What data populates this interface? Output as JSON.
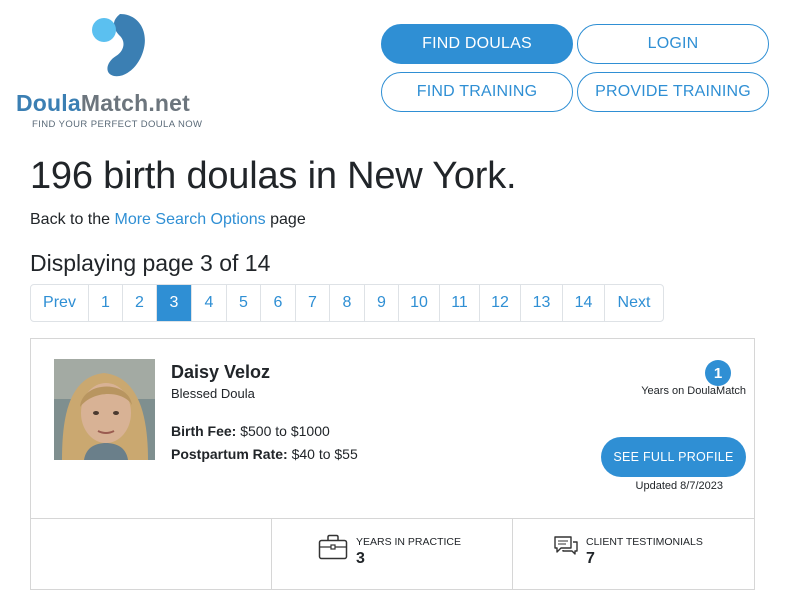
{
  "brand": {
    "name_part1": "Doula",
    "name_part2": "Match.net",
    "tagline": "FIND YOUR PERFECT DOULA NOW",
    "colors": {
      "primary": "#2f8fd4",
      "logo_blue": "#3b7fb3",
      "logo_light": "#5bc0f0"
    }
  },
  "nav": {
    "find_doulas": "FIND DOULAS",
    "login": "LOGIN",
    "find_training": "FIND TRAINING",
    "provide_training": "PROVIDE TRAINING"
  },
  "heading": {
    "title": "196 birth doulas in New York.",
    "back_prefix": "Back to the ",
    "back_link": "More Search Options",
    "back_suffix": " page",
    "page_indicator": "Displaying page 3 of 14"
  },
  "pagination": {
    "prev": "Prev",
    "next": "Next",
    "pages": [
      "1",
      "2",
      "3",
      "4",
      "5",
      "6",
      "7",
      "8",
      "9",
      "10",
      "11",
      "12",
      "13",
      "14"
    ],
    "current": "3"
  },
  "profile": {
    "name": "Daisy Veloz",
    "subtitle": "Blessed Doula",
    "birth_fee_label": "Birth Fee:",
    "birth_fee_value": "$500 to $1000",
    "postpartum_label": "Postpartum Rate:",
    "postpartum_value": "$40 to $55",
    "years_badge": "1",
    "years_label": "Years on DoulaMatch",
    "profile_button": "SEE FULL PROFILE",
    "updated": "Updated 8/7/2023",
    "stats": {
      "practice_label": "YEARS IN PRACTICE",
      "practice_value": "3",
      "testimonials_label": "CLIENT TESTIMONIALS",
      "testimonials_value": "7"
    }
  },
  "icons": {
    "logo": "droplet-logo-icon",
    "practice": "briefcase-icon",
    "testimonials": "chat-bubbles-icon"
  }
}
